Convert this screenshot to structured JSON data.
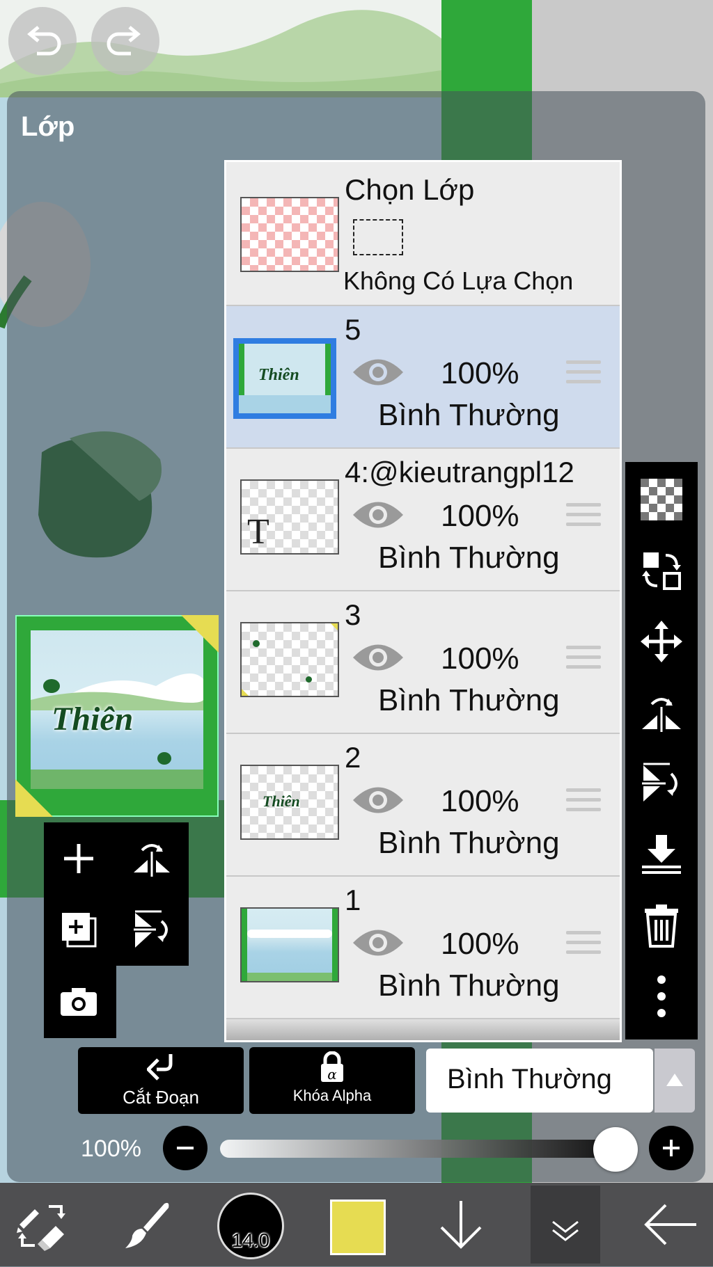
{
  "panel": {
    "title": "Lớp"
  },
  "selection_layer": {
    "title": "Chọn Lớp",
    "subtitle": "Không Có Lựa Chọn"
  },
  "layers": [
    {
      "name": "5",
      "opacity": "100%",
      "mode": "Bình Thường",
      "selected": true
    },
    {
      "name": "4:@kieutrangpl12",
      "opacity": "100%",
      "mode": "Bình Thường",
      "selected": false
    },
    {
      "name": "3",
      "opacity": "100%",
      "mode": "Bình Thường",
      "selected": false
    },
    {
      "name": "2",
      "opacity": "100%",
      "mode": "Bình Thường",
      "selected": false
    },
    {
      "name": "1",
      "opacity": "100%",
      "mode": "Bình Thường",
      "selected": false
    }
  ],
  "thumb_text": {
    "thien": "Thiên",
    "text_layer": "T"
  },
  "preview": {
    "title_text": "Thiên"
  },
  "buttons": {
    "clip": "Cắt Đoạn",
    "alpha_lock": "Khóa Alpha"
  },
  "blend_mode": "Bình Thường",
  "opacity_slider": {
    "label": "100%",
    "value": 1.0
  },
  "brush_size": "14.0",
  "colors": {
    "current_color": "#e6dc52",
    "selected_border": "#2f7de1",
    "canvas_green": "#2fa83a"
  }
}
